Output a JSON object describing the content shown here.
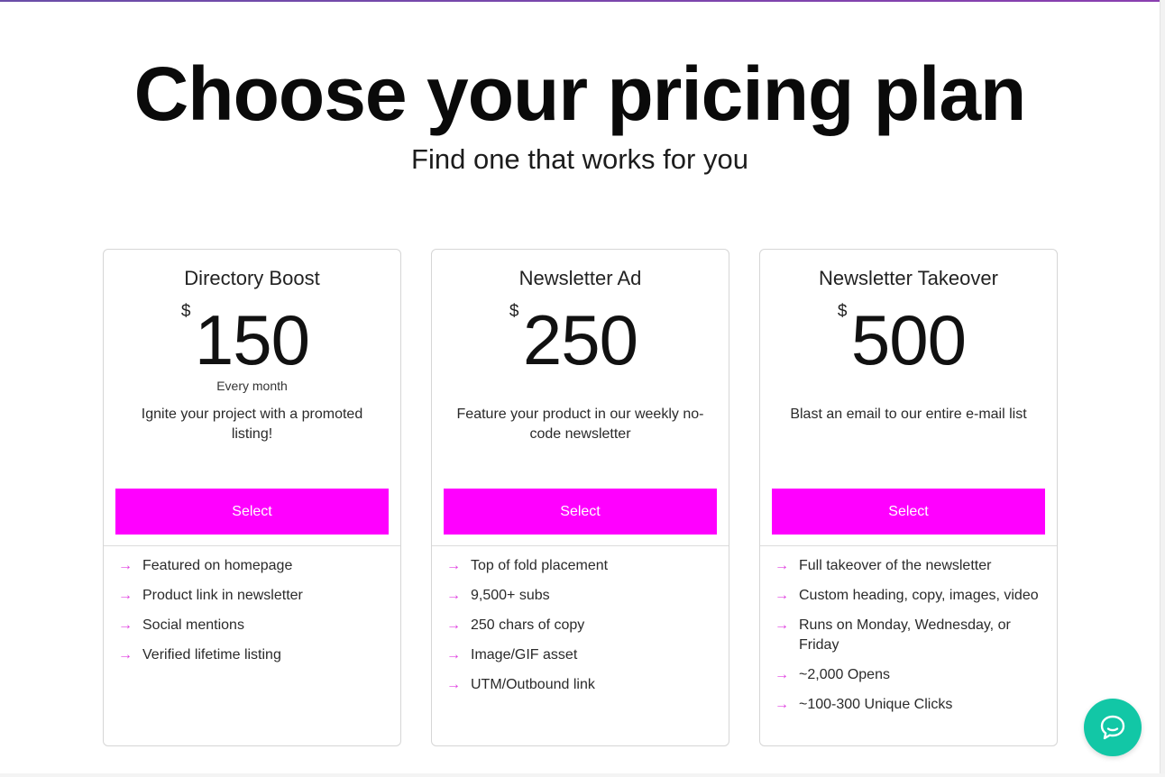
{
  "hero": {
    "title": "Choose your pricing plan",
    "subtitle": "Find one that works for you"
  },
  "colors": {
    "accent": "#ff00ff",
    "chat": "#12c7a6"
  },
  "plans": [
    {
      "name": "Directory Boost",
      "currency": "$",
      "amount": "150",
      "period": "Every month",
      "description": "Ignite your project with a promoted listing!",
      "button": "Select",
      "features": [
        "Featured on homepage",
        "Product link in newsletter",
        "Social mentions",
        "Verified lifetime listing"
      ]
    },
    {
      "name": "Newsletter Ad",
      "currency": "$",
      "amount": "250",
      "period": "",
      "description": "Feature your product in our weekly no-code newsletter",
      "button": "Select",
      "features": [
        "Top of fold placement",
        "9,500+ subs",
        "250 chars of copy",
        "Image/GIF asset",
        "UTM/Outbound link"
      ]
    },
    {
      "name": "Newsletter Takeover",
      "currency": "$",
      "amount": "500",
      "period": "",
      "description": "Blast an email to our entire e-mail list",
      "button": "Select",
      "features": [
        "Full takeover of the newsletter",
        "Custom heading, copy, images, video",
        "Runs on Monday, Wednesday, or Friday",
        "~2,000 Opens",
        "~100-300 Unique Clicks"
      ]
    }
  ],
  "icons": {
    "feature": "arrow-right-icon",
    "chat": "chat-bubble-icon"
  }
}
